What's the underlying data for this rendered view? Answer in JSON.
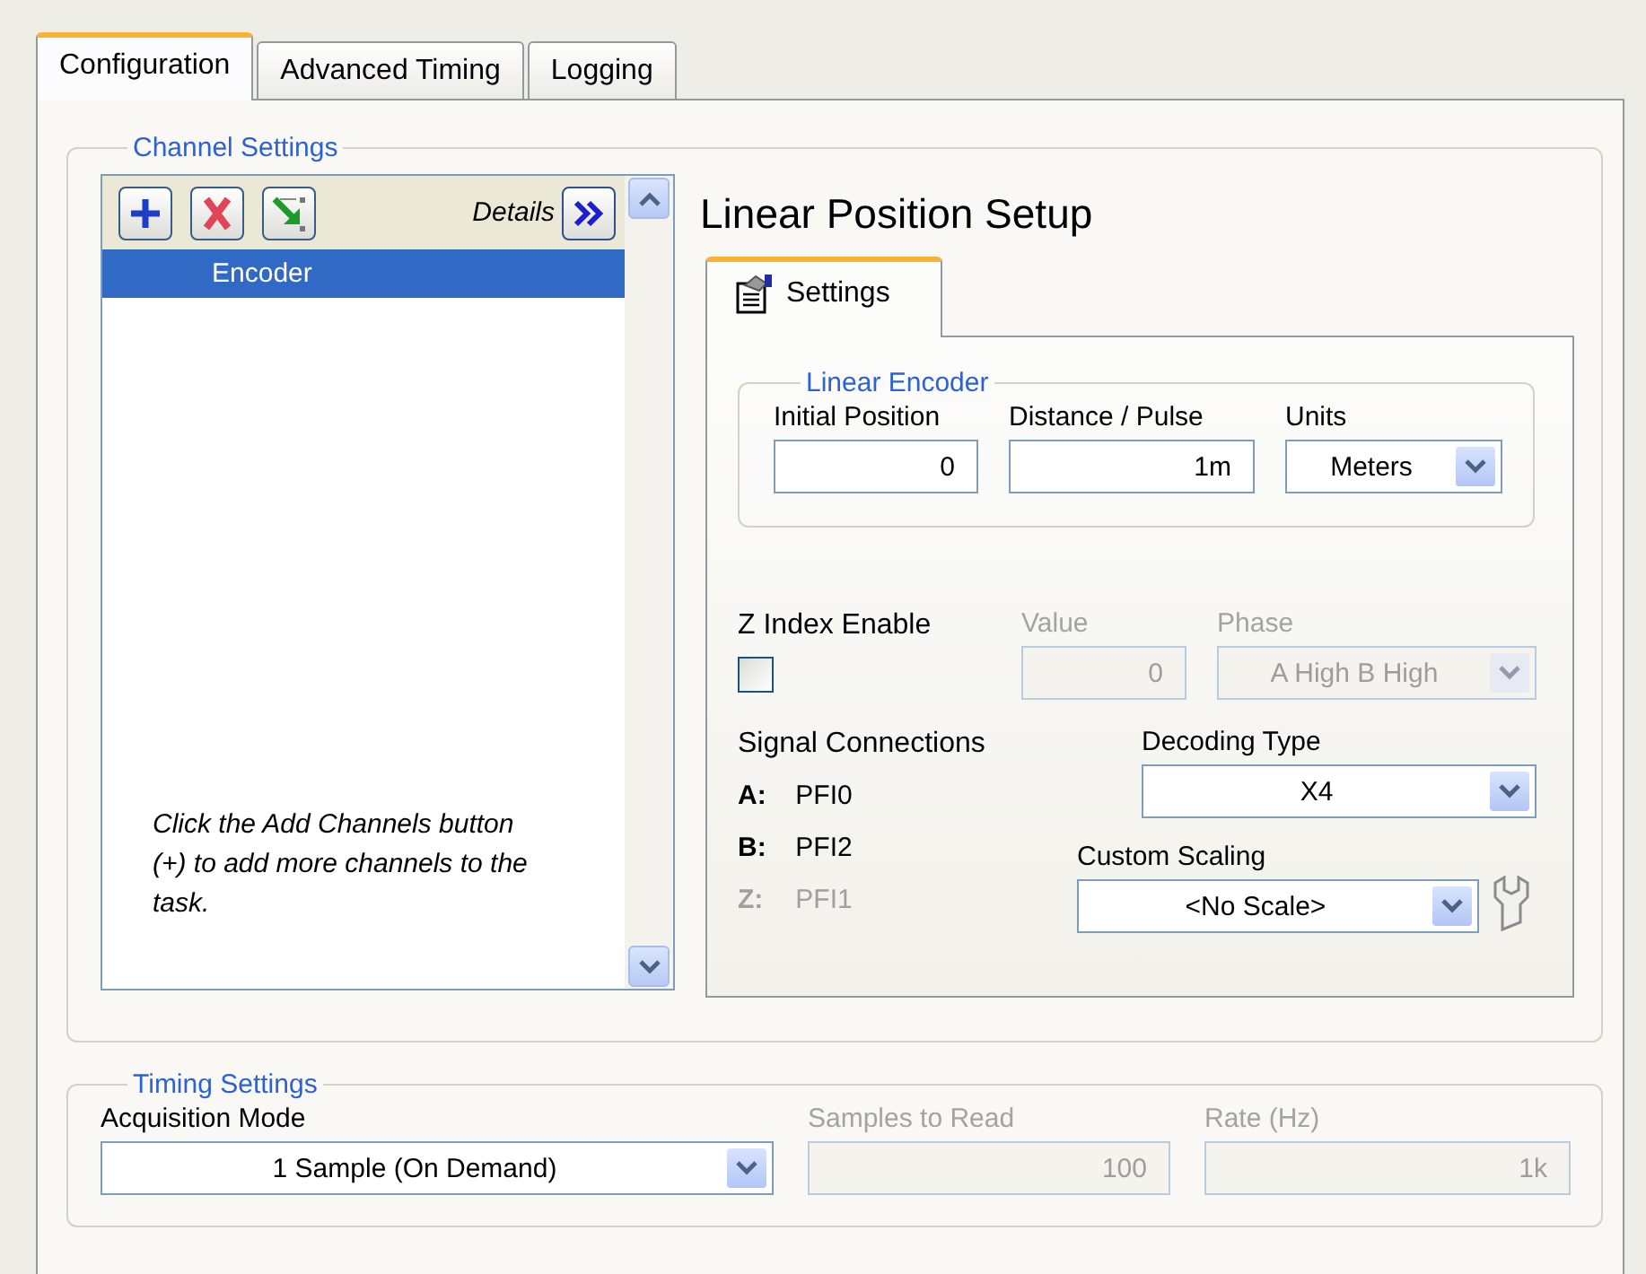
{
  "tabs": [
    {
      "label": "Configuration",
      "selected": true
    },
    {
      "label": "Advanced Timing",
      "selected": false
    },
    {
      "label": "Logging",
      "selected": false
    }
  ],
  "channel_settings": {
    "title": "Channel Settings",
    "details_label": "Details",
    "channels": [
      {
        "name": "Encoder",
        "selected": true
      }
    ],
    "hint": "Click the Add Channels button (+) to add more channels to the task.",
    "setup": {
      "title": "Linear Position Setup",
      "tabs": [
        {
          "label": "Settings",
          "selected": true
        }
      ],
      "linear_encoder": {
        "title": "Linear Encoder",
        "fields": [
          {
            "kind": "number",
            "label": "Initial Position",
            "value": "0",
            "disabled": false
          },
          {
            "kind": "number",
            "label": "Distance / Pulse",
            "value": "1m",
            "disabled": false
          },
          {
            "kind": "dropdown",
            "label": "Units",
            "value": "Meters",
            "disabled": false
          }
        ]
      },
      "z_index_enable": {
        "label": "Z Index Enable",
        "checked": false
      },
      "value": {
        "kind": "number",
        "label": "Value",
        "value": "0",
        "disabled": true
      },
      "phase": {
        "kind": "dropdown",
        "label": "Phase",
        "value": "A High B High",
        "disabled": true
      },
      "signal_connections": {
        "title": "Signal Connections",
        "rows": [
          {
            "terminal": "A:",
            "line": "PFI0",
            "disabled": false
          },
          {
            "terminal": "B:",
            "line": "PFI2",
            "disabled": false
          },
          {
            "terminal": "Z:",
            "line": "PFI1",
            "disabled": true
          }
        ]
      },
      "decoding_type": {
        "kind": "dropdown",
        "label": "Decoding Type",
        "value": "X4",
        "disabled": false
      },
      "custom_scaling": {
        "kind": "dropdown",
        "label": "Custom Scaling",
        "value": "<No Scale>",
        "disabled": false
      }
    }
  },
  "timing_settings": {
    "title": "Timing Settings",
    "fields": [
      {
        "kind": "dropdown",
        "label": "Acquisition Mode",
        "value": "1 Sample (On Demand)",
        "disabled": false
      },
      {
        "kind": "number",
        "label": "Samples to Read",
        "value": "100",
        "disabled": true
      },
      {
        "kind": "number",
        "label": "Rate (Hz)",
        "value": "1k",
        "disabled": true
      }
    ]
  }
}
